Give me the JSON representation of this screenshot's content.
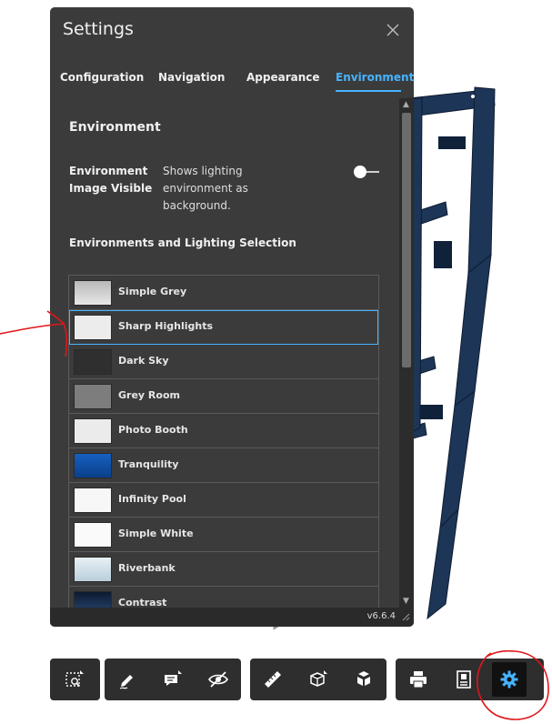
{
  "settings": {
    "title": "Settings",
    "tabs": [
      {
        "label": "Configuration",
        "active": false
      },
      {
        "label": "Navigation",
        "active": false
      },
      {
        "label": "Appearance",
        "active": false
      },
      {
        "label": "Environment",
        "active": true
      }
    ],
    "section_title": "Environment",
    "env_visible": {
      "label": "Environment Image Visible",
      "description": "Shows lighting environment as background.",
      "enabled": false
    },
    "lighting_title": "Environments and Lighting Selection",
    "environments": [
      {
        "name": "Simple Grey",
        "selected": false
      },
      {
        "name": "Sharp Highlights",
        "selected": true
      },
      {
        "name": "Dark Sky",
        "selected": false
      },
      {
        "name": "Grey Room",
        "selected": false
      },
      {
        "name": "Photo Booth",
        "selected": false
      },
      {
        "name": "Tranquility",
        "selected": false
      },
      {
        "name": "Infinity Pool",
        "selected": false
      },
      {
        "name": "Simple White",
        "selected": false
      },
      {
        "name": "Riverbank",
        "selected": false
      },
      {
        "name": "Contrast",
        "selected": false
      }
    ],
    "version": "v6.6.4"
  },
  "colors": {
    "accent": "#46b4ff",
    "panel": "#2c2c2c",
    "annotation": "#e0161b",
    "swatches": [
      "#c8c8c8",
      "#ececec",
      "#2f2f2f",
      "#7d7d7d",
      "#ebebeb",
      "#0d4fa8",
      "#f7f7f7",
      "#fafafa",
      "#d4e2ea",
      "#14223a"
    ]
  },
  "toolbar": {
    "groups": [
      [
        "fit-to-view-icon"
      ],
      [
        "markup-pen-icon",
        "comment-icon",
        "hide-icon"
      ],
      [
        "measure-ruler-icon",
        "section-box-icon",
        "explode-cube-icon"
      ],
      [
        "print-icon",
        "properties-icon",
        "settings-gear-icon"
      ]
    ],
    "active": "settings-gear-icon"
  }
}
